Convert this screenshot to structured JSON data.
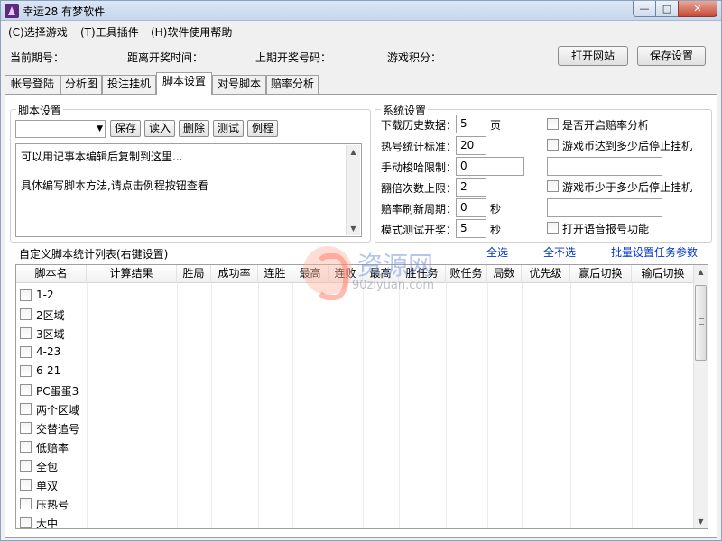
{
  "window": {
    "title": "幸运28 有梦软件",
    "min_glyph": "—",
    "max_glyph": "□",
    "close_glyph": "✕"
  },
  "menu": [
    "(C)选择游戏",
    "(T)工具插件",
    "(H)软件使用帮助"
  ],
  "info": {
    "current_issue": "当前期号：",
    "countdown": "距离开奖时间：",
    "last_numbers": "上期开奖号码：",
    "points": "游戏积分："
  },
  "buttons": {
    "open_site": "打开网站",
    "save_settings": "保存设置"
  },
  "tabs": [
    "帐号登陆",
    "分析图",
    "投注挂机",
    "脚本设置",
    "对号脚本",
    "赔率分析"
  ],
  "active_tab": "脚本设置",
  "script": {
    "group_title": "脚本设置",
    "combo_value": "",
    "buttons": [
      "保存",
      "读入",
      "删除",
      "测试",
      "例程"
    ],
    "text_lines": [
      "可以用记事本编辑后复制到这里...",
      "",
      "具体编写脚本方法,请点击例程按钮查看"
    ]
  },
  "system": {
    "group_title": "系统设置",
    "fields": [
      {
        "label": "下载历史数据：",
        "value": "5",
        "unit": "页"
      },
      {
        "label": "热号统计标准：",
        "value": "20",
        "unit": ""
      },
      {
        "label": "手动梭哈限制：",
        "value": "0",
        "unit": ""
      },
      {
        "label": "翻倍次数上限：",
        "value": "2",
        "unit": ""
      },
      {
        "label": "赔率刷新周期：",
        "value": "0",
        "unit": "秒"
      },
      {
        "label": "模式测试开奖：",
        "value": "5",
        "unit": "秒"
      }
    ],
    "checks": [
      {
        "label": "是否开启赔率分析",
        "value": ""
      },
      {
        "label": "游戏币达到多少后停止挂机",
        "value": ""
      },
      {
        "label": "游戏币少于多少后停止挂机",
        "value": ""
      },
      {
        "label": "打开语音报号功能",
        "value": ""
      }
    ]
  },
  "list": {
    "title": "自定义脚本统计列表(右键设置)",
    "links": [
      "全选",
      "全不选",
      "批量设置任务参数"
    ],
    "columns": [
      "脚本名",
      "计算结果",
      "胜局",
      "成功率",
      "连胜",
      "最高",
      "连败",
      "最高",
      "胜任务",
      "败任务",
      "局数",
      "优先级",
      "赢后切换",
      "输后切换"
    ],
    "rows": [
      "1-2",
      "2区域",
      "3区域",
      "4-23",
      "6-21",
      "PC蛋蛋3",
      "两个区域",
      "交替追号",
      "低赔率",
      "全包",
      "单双",
      "压热号",
      "大中"
    ]
  },
  "watermark": {
    "brand": "资源网",
    "url": "90ziyuan.com"
  }
}
